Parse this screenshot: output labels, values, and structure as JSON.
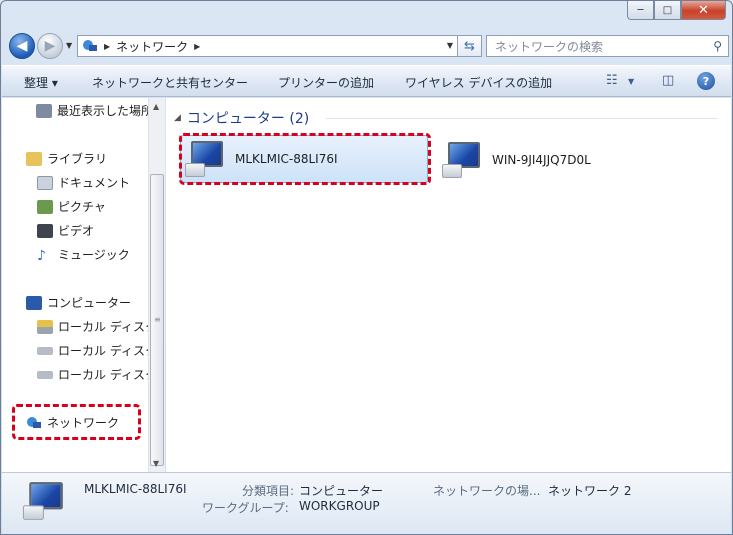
{
  "window": {
    "caption": {
      "minimize": "─",
      "maximize": "□",
      "close": "✕"
    }
  },
  "nav": {
    "back_icon": "back-arrow-icon",
    "forward_icon": "forward-arrow-icon",
    "address_path": "ネットワーク",
    "search_placeholder": "ネットワークの検索"
  },
  "toolbar": {
    "organize": "整理 ▾",
    "network_center": "ネットワークと共有センター",
    "add_printer": "プリンターの追加",
    "add_wireless": "ワイヤレス デバイスの追加",
    "help": "?"
  },
  "sidebar": {
    "items": [
      {
        "label": "最近表示した場所",
        "icon": "recent-places-icon",
        "color": "#7d8aa0"
      },
      {
        "label": "ライブラリ",
        "icon": "library-folder-icon",
        "color": "#e8c25a"
      },
      {
        "label": "ドキュメント",
        "icon": "document-icon",
        "color": "#c9d2de"
      },
      {
        "label": "ピクチャ",
        "icon": "pictures-icon",
        "color": "#6b9a4e"
      },
      {
        "label": "ビデオ",
        "icon": "video-icon",
        "color": "#3d4450"
      },
      {
        "label": "ミュージック",
        "icon": "music-icon",
        "color": "#2f73c6"
      },
      {
        "label": "コンピューター",
        "icon": "computer-icon",
        "color": "#2a5aa8"
      },
      {
        "label": "ローカル ディスク",
        "icon": "system-disk-icon",
        "color": "#9aa3ae"
      },
      {
        "label": "ローカル ディスク",
        "icon": "disk-icon",
        "color": "#b5bcc6"
      },
      {
        "label": "ローカル ディスク",
        "icon": "disk-icon",
        "color": "#b5bcc6"
      },
      {
        "label": "ネットワーク",
        "icon": "network-icon",
        "color": "#2a7ad0"
      }
    ]
  },
  "content": {
    "group_title": "コンピューター (2)",
    "computers": [
      {
        "name": "MLKLMIC-88LI76I",
        "selected": true
      },
      {
        "name": "WIN-9JI4JJQ7D0L",
        "selected": false
      }
    ]
  },
  "details": {
    "name": "MLKLMIC-88LI76I",
    "category_label": "分類項目:",
    "category_value": "コンピューター",
    "workgroup_label": "ワークグループ:",
    "workgroup_value": "WORKGROUP",
    "network_location_label": "ネットワークの場...",
    "network_location_value": "ネットワーク 2"
  },
  "highlight_color": "#d9001b"
}
